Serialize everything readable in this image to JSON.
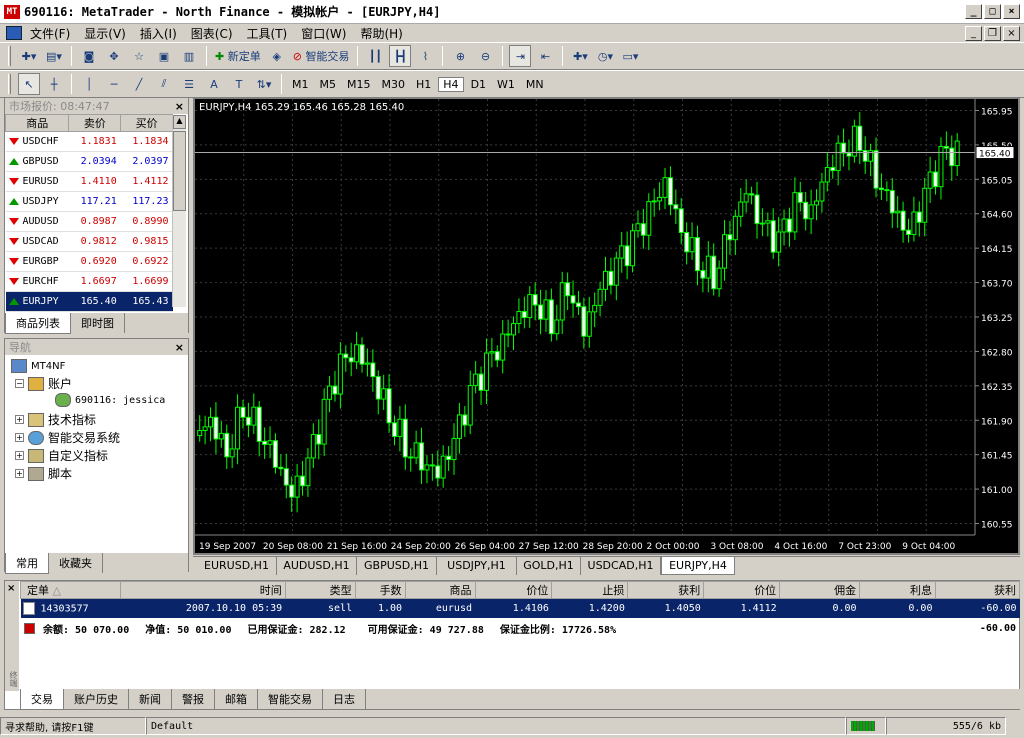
{
  "window": {
    "title": "690116: MetaTrader - North Finance - 模拟帐户 - [EURJPY,H4]",
    "logo": "MT"
  },
  "menu": [
    "文件(F)",
    "显示(V)",
    "插入(I)",
    "图表(C)",
    "工具(T)",
    "窗口(W)",
    "帮助(H)"
  ],
  "toolbar": {
    "new_order": "新定单",
    "expert_advisors": "智能交易"
  },
  "draw_tools": {
    "text_tool": "A",
    "label_tool": "T"
  },
  "timeframes": [
    "M1",
    "M5",
    "M15",
    "M30",
    "H1",
    "H4",
    "D1",
    "W1",
    "MN"
  ],
  "timeframe_selected": "H4",
  "market_watch": {
    "title": "市场报价: 08:47:47",
    "columns": [
      "商品",
      "卖价",
      "买价"
    ],
    "rows": [
      {
        "symbol": "USDCHF",
        "bid": "1.1831",
        "ask": "1.1834",
        "dir": "down"
      },
      {
        "symbol": "GBPUSD",
        "bid": "2.0394",
        "ask": "2.0397",
        "dir": "up"
      },
      {
        "symbol": "EURUSD",
        "bid": "1.4110",
        "ask": "1.4112",
        "dir": "down"
      },
      {
        "symbol": "USDJPY",
        "bid": "117.21",
        "ask": "117.23",
        "dir": "up"
      },
      {
        "symbol": "AUDUSD",
        "bid": "0.8987",
        "ask": "0.8990",
        "dir": "down"
      },
      {
        "symbol": "USDCAD",
        "bid": "0.9812",
        "ask": "0.9815",
        "dir": "down"
      },
      {
        "symbol": "EURGBP",
        "bid": "0.6920",
        "ask": "0.6922",
        "dir": "down"
      },
      {
        "symbol": "EURCHF",
        "bid": "1.6697",
        "ask": "1.6699",
        "dir": "down"
      },
      {
        "symbol": "EURJPY",
        "bid": "165.40",
        "ask": "165.43",
        "dir": "up"
      }
    ],
    "tabs": [
      "商品列表",
      "即时图"
    ]
  },
  "navigator": {
    "title": "导航",
    "root": "MT4NF",
    "accounts": "账户",
    "account": "690116: jessica",
    "items": [
      "技术指标",
      "智能交易系统",
      "自定义指标",
      "脚本"
    ],
    "tabs": [
      "常用",
      "收藏夹"
    ]
  },
  "chart": {
    "header": "EURJPY,H4  165.29 165.46 165.28 165.40",
    "price_ticks": [
      "165.95",
      "165.50",
      "165.05",
      "164.60",
      "164.15",
      "163.70",
      "163.25",
      "162.80",
      "162.35",
      "161.90",
      "161.45",
      "161.00",
      "160.55"
    ],
    "current_price": "165.40",
    "date_ticks": [
      "19 Sep 2007",
      "20 Sep 08:00",
      "21 Sep 16:00",
      "24 Sep 20:00",
      "26 Sep 04:00",
      "27 Sep 12:00",
      "28 Sep 20:00",
      "2 Oct 00:00",
      "3 Oct 08:00",
      "4 Oct 16:00",
      "7 Oct 23:00",
      "9 Oct 04:00"
    ],
    "tabs": [
      "EURUSD,H1",
      "AUDUSD,H1",
      "GBPUSD,H1",
      "USDJPY,H1",
      "GOLD,H1",
      "USDCAD,H1",
      "EURJPY,H4"
    ],
    "active_tab": "EURJPY,H4",
    "colors": {
      "background": "#000000",
      "candle": "#00ff00",
      "grid": "#3a3a3a"
    }
  },
  "chart_data": {
    "type": "line",
    "title": "EURJPY,H4",
    "xlabel": "",
    "ylabel": "",
    "ylim": [
      160.4,
      166.1
    ],
    "x_range": [
      "19 Sep 2007",
      "9 Oct 2007"
    ],
    "grid": true,
    "series": [
      {
        "name": "EURJPY",
        "values": [
          161.7,
          161.9,
          161.5,
          162.1,
          161.8,
          161.4,
          160.9,
          161.3,
          162.0,
          162.6,
          162.8,
          162.5,
          162.0,
          161.6,
          161.4,
          161.2,
          161.6,
          162.2,
          162.6,
          162.9,
          163.3,
          163.5,
          163.2,
          163.7,
          163.1,
          163.6,
          163.9,
          164.2,
          164.6,
          165.0,
          164.4,
          164.0,
          163.8,
          164.4,
          164.9,
          164.4,
          164.2,
          164.7,
          164.6,
          165.2,
          165.5,
          165.6,
          165.1,
          164.7,
          164.3,
          164.8,
          165.3,
          165.4
        ]
      }
    ]
  },
  "terminal": {
    "columns": [
      "定单",
      "时间",
      "类型",
      "手数",
      "商品",
      "价位",
      "止损",
      "获利",
      "价位",
      "佣金",
      "利息",
      "获利"
    ],
    "order": {
      "ticket": "14303577",
      "time": "2007.10.10 05:39",
      "type": "sell",
      "lots": "1.00",
      "symbol": "eurusd",
      "price": "1.4106",
      "sl": "1.4200",
      "tp": "1.4050",
      "cur_price": "1.4112",
      "commission": "0.00",
      "swap": "0.00",
      "profit": "-60.00"
    },
    "summary": {
      "balance": "余额: 50 070.00",
      "equity": "净值: 50 010.00",
      "margin": "已用保证金: 282.12",
      "free_margin": "可用保证金: 49 727.88",
      "margin_level": "保证金比例: 17726.58%",
      "total": "-60.00"
    },
    "tabs": [
      "交易",
      "账户历史",
      "新闻",
      "警报",
      "邮箱",
      "智能交易",
      "日志"
    ],
    "side_label": "终端"
  },
  "status": {
    "help": "寻求帮助, 请按F1键",
    "profile": "Default",
    "traffic": "555/6 kb"
  }
}
